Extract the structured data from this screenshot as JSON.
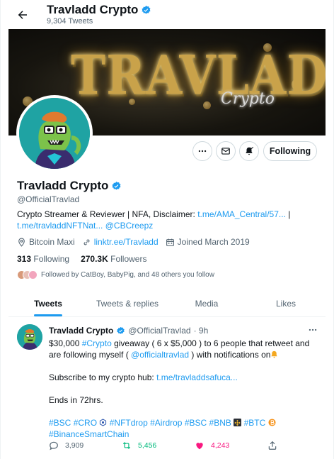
{
  "header": {
    "title": "Travladd Crypto",
    "tweet_count": "9,304 Tweets"
  },
  "banner": {
    "title": "TRAVLADD",
    "subtitle": "Crypto"
  },
  "actions": {
    "following_label": "Following"
  },
  "profile": {
    "name": "Travladd Crypto",
    "handle": "@OfficialTravlad",
    "bio_text": "Crypto Streamer & Reviewer | NFA, Disclaimer: ",
    "bio_link1": "t.me/AMA_Central/57...",
    "bio_sep": " | ",
    "bio_link2": "t.me/travladdNFTNat...",
    "bio_mention": "@CBCreepz",
    "location": "Bitcoin Maxi",
    "website": "linktr.ee/Travladd",
    "joined": "Joined March 2019",
    "following_count": "313",
    "following_label": "Following",
    "followers_count": "270.3K",
    "followers_label": "Followers",
    "followed_by": "Followed by CatBoy, BabyPig, and 48 others you follow"
  },
  "tabs": [
    "Tweets",
    "Tweets & replies",
    "Media",
    "Likes"
  ],
  "tweet": {
    "name": "Travladd Crypto",
    "handle": "@OfficialTravlad",
    "time": "· 9h",
    "l1_a": "$30,000 ",
    "l1_tag": "#Crypto",
    "l1_b": " giveaway ( 6 x $5,000 ) to 6 people that retweet and are following myself ( ",
    "l1_mention": "@officialtravlad",
    "l1_c": " ) with notifications on",
    "l2_a": "Subscribe to my crypto hub: ",
    "l2_link": "t.me/travladdsafuca...",
    "l3": "Ends in 72hrs.",
    "tags": {
      "bsc1": "#BSC",
      "cro": "#CRO",
      "nftdrop": "#NFTdrop",
      "airdrop": "#Airdrop",
      "bsc2": "#BSC",
      "bnb": "#BNB",
      "btc": "#BTC",
      "binance": "#BinanceSmartChain"
    },
    "replies": "3,909",
    "retweets": "5,456",
    "likes": "4,243"
  },
  "colors": {
    "accent": "#1d9bf0",
    "retweet": "#00ba7c",
    "like": "#f91880"
  }
}
